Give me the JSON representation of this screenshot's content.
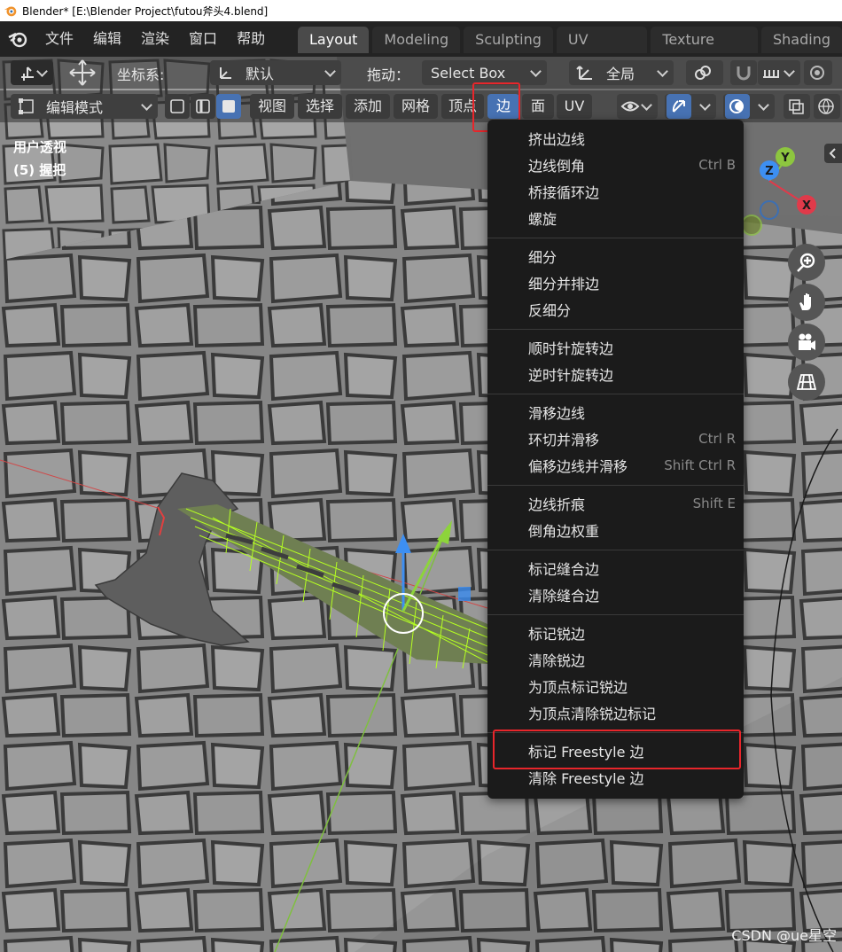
{
  "window": {
    "title": "Blender* [E:\\Blender Project\\futou斧头4.blend]"
  },
  "topmenu": [
    "文件",
    "编辑",
    "渲染",
    "窗口",
    "帮助"
  ],
  "workspace_tabs": [
    {
      "label": "Layout",
      "active": true
    },
    {
      "label": "Modeling",
      "active": false
    },
    {
      "label": "Sculpting",
      "active": false
    },
    {
      "label": "UV Editing",
      "active": false
    },
    {
      "label": "Texture Paint",
      "active": false
    },
    {
      "label": "Shading",
      "active": false
    }
  ],
  "header1": {
    "coord_label": "坐标系:",
    "coord_value": "默认",
    "drag_label": "拖动：",
    "drag_value": "Select Box",
    "pivot_value": "全局"
  },
  "header2": {
    "mode": "编辑模式",
    "menus": [
      {
        "label": "视图",
        "active": false
      },
      {
        "label": "选择",
        "active": false
      },
      {
        "label": "添加",
        "active": false
      },
      {
        "label": "网格",
        "active": false
      },
      {
        "label": "顶点",
        "active": false
      },
      {
        "label": "边",
        "active": true
      },
      {
        "label": "面",
        "active": false
      },
      {
        "label": "UV",
        "active": false
      }
    ]
  },
  "viewport_info": {
    "line1": "用户透视",
    "line2": "(5) 握把"
  },
  "gizmo": {
    "x": "X",
    "y": "Y",
    "z": "Z"
  },
  "edge_menu": {
    "groups": [
      [
        {
          "label": "挤出边线",
          "shortcut": ""
        },
        {
          "label": "边线倒角",
          "shortcut": "Ctrl B"
        },
        {
          "label": "桥接循环边",
          "shortcut": ""
        },
        {
          "label": "螺旋",
          "shortcut": ""
        }
      ],
      [
        {
          "label": "细分",
          "shortcut": ""
        },
        {
          "label": "细分并排边",
          "shortcut": ""
        },
        {
          "label": "反细分",
          "shortcut": ""
        }
      ],
      [
        {
          "label": "顺时针旋转边",
          "shortcut": ""
        },
        {
          "label": "逆时针旋转边",
          "shortcut": ""
        }
      ],
      [
        {
          "label": "滑移边线",
          "shortcut": ""
        },
        {
          "label": "环切并滑移",
          "shortcut": "Ctrl R"
        },
        {
          "label": "偏移边线并滑移",
          "shortcut": "Shift Ctrl R"
        }
      ],
      [
        {
          "label": "边线折痕",
          "shortcut": "Shift E"
        },
        {
          "label": "倒角边权重",
          "shortcut": ""
        }
      ],
      [
        {
          "label": "标记缝合边",
          "shortcut": ""
        },
        {
          "label": "清除缝合边",
          "shortcut": ""
        }
      ],
      [
        {
          "label": "标记锐边",
          "shortcut": ""
        },
        {
          "label": "清除锐边",
          "shortcut": ""
        },
        {
          "label": "为顶点标记锐边",
          "shortcut": ""
        },
        {
          "label": "为顶点清除锐边标记",
          "shortcut": ""
        }
      ],
      [
        {
          "label": "标记 Freestyle 边",
          "shortcut": ""
        },
        {
          "label": "清除 Freestyle 边",
          "shortcut": ""
        }
      ]
    ]
  },
  "watermark": "CSDN @ue星空",
  "colors": {
    "accent": "#4772b3",
    "highlight": "#e8262b",
    "menu_bg": "#1b1b1b"
  }
}
